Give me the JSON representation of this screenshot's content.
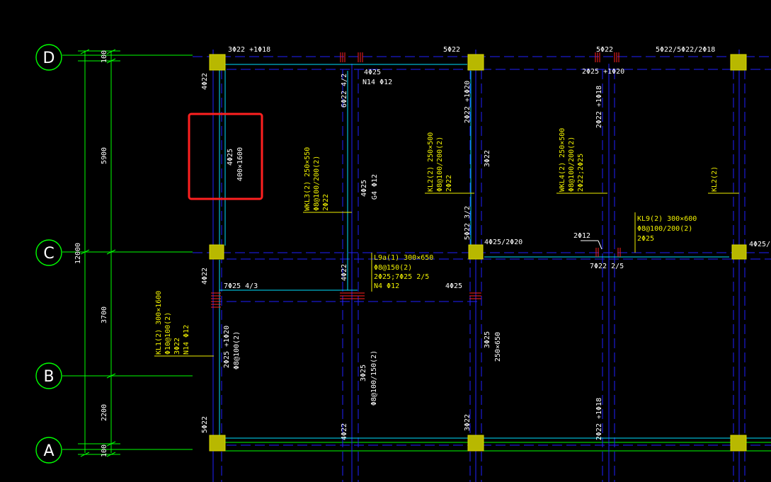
{
  "colors": {
    "background": "#000000",
    "axis": "#00ff00",
    "beam": "#00ffff",
    "center": "#0000ff",
    "column": "#b8b800",
    "rebar": "#ff2020",
    "label": "#f0f000",
    "text": "#ffffff",
    "highlight": "#ff2020"
  },
  "axes": {
    "D": "D",
    "C": "C",
    "B": "B",
    "A": "A"
  },
  "dims": {
    "d_top": "100",
    "d_5900": "5900",
    "d_3700": "3700",
    "d_2200": "2200",
    "d_bot": "100",
    "d_total": "12000"
  },
  "top_row": {
    "t1": "3Φ22 +1Φ18",
    "t2": "5Φ22",
    "t3": "5Φ22",
    "t4": "5Φ22/5Φ22/2Φ18",
    "t5": "4Φ25",
    "t6": "N14 Φ12",
    "t7": "2Φ25 +1Φ20"
  },
  "vertical_white": {
    "v1": "4Φ22",
    "v2": "6Φ22  4/2",
    "v3": "2Φ22 +1Φ20",
    "v4": "2Φ22 +1Φ18",
    "v5": "4Φ25",
    "v6": "400×1600",
    "v7": "4Φ25",
    "v8": "G4 Φ12",
    "v9": "3Φ22",
    "v10": "5Φ22  3/2",
    "v11": "4Φ22",
    "v12": "4Φ22",
    "v13": "2Φ25 +1Φ20",
    "v14": "Φ8@100(2)",
    "v15": "3Φ25",
    "v16": "Φ8@100/150(2)",
    "v17": "3Φ25",
    "v18": "250×650",
    "v19": "5Φ22",
    "v20": "4Φ22",
    "v21": "3Φ22",
    "v22": "2Φ22 +1Φ18"
  },
  "horizontal_white": {
    "h1": "4Φ25/2Φ20",
    "h2": "2Φ12",
    "h3": "7Φ22 2/5",
    "h4": "4Φ25/",
    "h5": "7Φ25  4/3",
    "h6": "4Φ25"
  },
  "yellow_labels": {
    "wkl3": [
      "WKL3(2) 250×550",
      "Φ8@100/200(2)",
      "2Φ22"
    ],
    "kl2": [
      "KL2(2) 250×500",
      "Φ8@100/200(2)",
      "2Φ22"
    ],
    "wkl4": [
      "WKL4(2) 250×500",
      "Φ8@100/200(2)",
      "2Φ22;2Φ25"
    ],
    "kl2b": [
      "KL2(2)"
    ],
    "kl9": [
      "KL9(2) 300×600",
      "Φ8@100/200(2)",
      "2Φ25"
    ],
    "l9": [
      "L9a(1) 300×650",
      "Φ8@150(2)",
      "2Φ25;7Φ25 2/5",
      "N4 Φ12"
    ],
    "kl1": [
      "KL1(2) 300×1600",
      "Φ10@100(2)",
      "3Φ22",
      "N14 Φ12"
    ]
  }
}
